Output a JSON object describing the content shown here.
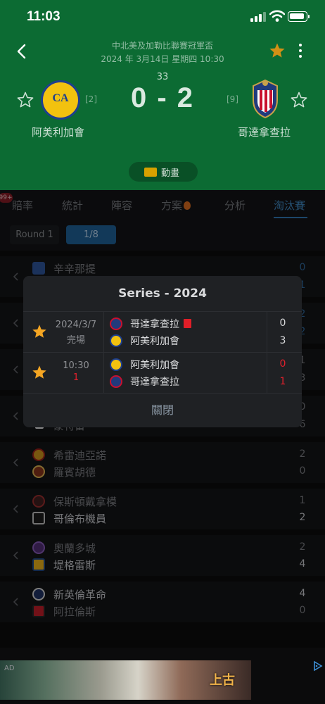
{
  "status_bar": {
    "time": "11:03"
  },
  "match": {
    "competition": "中北美及加勒比聯賽冠軍盃",
    "datetime": "2024 年 3月14日 星期四 10:30",
    "minute": "33",
    "score": "0 - 2",
    "home": {
      "name": "阿美利加會",
      "rank": "[2]"
    },
    "away": {
      "name": "哥達拿查拉",
      "rank": "[9]"
    },
    "animation_label": "動畫"
  },
  "notification_badge": "99+",
  "tabs": [
    {
      "label": "賠率",
      "active": false
    },
    {
      "label": "統計",
      "active": false
    },
    {
      "label": "陣容",
      "active": false
    },
    {
      "label": "方案",
      "active": false
    },
    {
      "label": "分析",
      "active": false
    },
    {
      "label": "淘汰賽",
      "active": true
    }
  ],
  "rounds": [
    {
      "label": "Round 1",
      "active": false
    },
    {
      "label": "1/8",
      "active": true
    }
  ],
  "bracket": [
    {
      "team1": "辛辛那提",
      "team2": "",
      "score1": "0",
      "score2": "1"
    },
    {
      "team1": "",
      "team2": "",
      "score1": "2",
      "score2": "2"
    },
    {
      "team1": "",
      "team2": "",
      "score1": "1",
      "score2": "3"
    },
    {
      "team1": "",
      "team2": "蒙特雷",
      "score1": "0",
      "score2": "6"
    },
    {
      "team1": "希雷迪亞諾",
      "team2": "羅賓胡德",
      "score1": "2",
      "score2": "0"
    },
    {
      "team1": "保斯頓戴拿模",
      "team2": "哥倫布機員",
      "score1": "1",
      "score2": "2"
    },
    {
      "team1": "奧蘭多城",
      "team2": "堤格雷斯",
      "score1": "2",
      "score2": "4"
    },
    {
      "team1": "新英倫革命",
      "team2": "阿拉倫斯",
      "score1": "4",
      "score2": "0"
    }
  ],
  "series_dialog": {
    "title": "Series - 2024",
    "games": [
      {
        "date": "2024/3/7",
        "status": "完場",
        "status_color": "#8e9094",
        "team1": "哥達拿查拉",
        "team1_red_card": true,
        "team2": "阿美利加會",
        "score1": "0",
        "score2": "3",
        "score_color": "#d9dadc"
      },
      {
        "date": "10:30",
        "status": "1",
        "status_color": "#e3202c",
        "team1": "阿美利加會",
        "team1_red_card": false,
        "team2": "哥達拿查拉",
        "score1": "0",
        "score2": "1",
        "score_color": "#e3202c"
      }
    ],
    "close_label": "關閉"
  },
  "ad": {
    "label": "AD",
    "brand": "上古"
  },
  "colors": {
    "header_green": "#0c6b33",
    "accent_blue": "#3a7bb0",
    "star_gold": "#f5a623",
    "red_card": "#e01e28"
  }
}
